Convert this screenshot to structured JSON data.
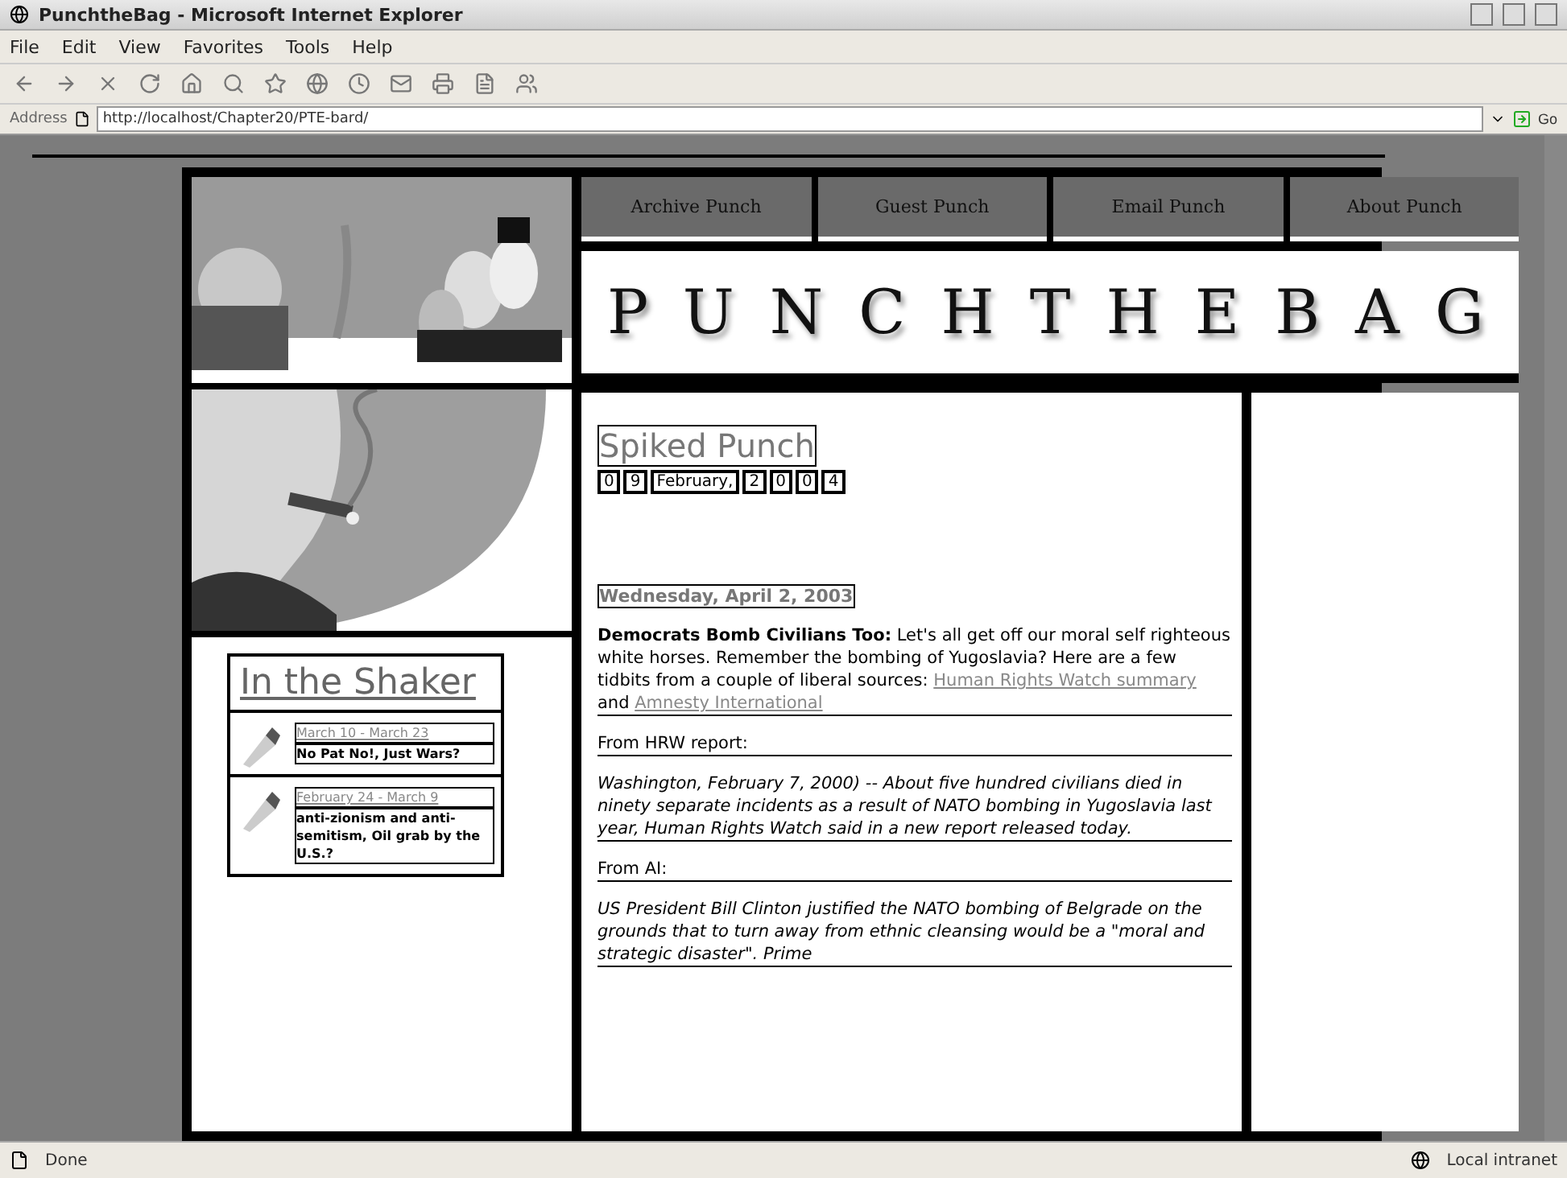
{
  "window": {
    "title": "PunchtheBag - Microsoft Internet Explorer"
  },
  "menu": [
    "File",
    "Edit",
    "View",
    "Favorites",
    "Tools",
    "Help"
  ],
  "address": {
    "label": "Address",
    "url": "http://localhost/Chapter20/PTE-bard/",
    "go": "Go"
  },
  "page": {
    "nav": [
      "Archive Punch",
      "Guest Punch",
      "Email Punch",
      "About Punch"
    ],
    "logo": "PUNCHTHEBAG",
    "sidebar": {
      "title": "In the Shaker",
      "items": [
        {
          "date": "March 10 - March 23",
          "text": "No Pat No!, Just Wars?"
        },
        {
          "date": "February 24 - March 9",
          "text": "anti-zionism and anti-semitism, Oil grab by the U.S.?"
        }
      ]
    },
    "section_title": "Spiked Punch",
    "date_parts": [
      "0",
      "9",
      "February,",
      "2",
      "0",
      "0",
      "4"
    ],
    "post": {
      "date": "Wednesday, April 2, 2003",
      "paragraphs": [
        {
          "kind": "lead",
          "headline": "Democrats Bomb Civilians Too:",
          "text": "Let's all get off our moral self righteous white horses. Remember the bombing of Yugoslavia? Here are a few tidbits from a couple of liberal sources:",
          "link1": "Human Rights Watch summary",
          "joiner": "and",
          "link2": "Amnesty International"
        },
        {
          "kind": "label",
          "text": "From HRW report:"
        },
        {
          "kind": "quote",
          "text": "Washington, February 7, 2000) -- About five hundred civilians died in ninety separate incidents as a result of NATO bombing in Yugoslavia last year, Human Rights Watch said in a new report released today."
        },
        {
          "kind": "label",
          "text": "From AI:"
        },
        {
          "kind": "quote",
          "text": "US President Bill Clinton justified the NATO bombing of Belgrade on the grounds that to turn away from ethnic cleansing would be a \"moral and strategic disaster\". Prime"
        }
      ]
    }
  },
  "status": {
    "text": "Done",
    "zone": "Local intranet"
  }
}
